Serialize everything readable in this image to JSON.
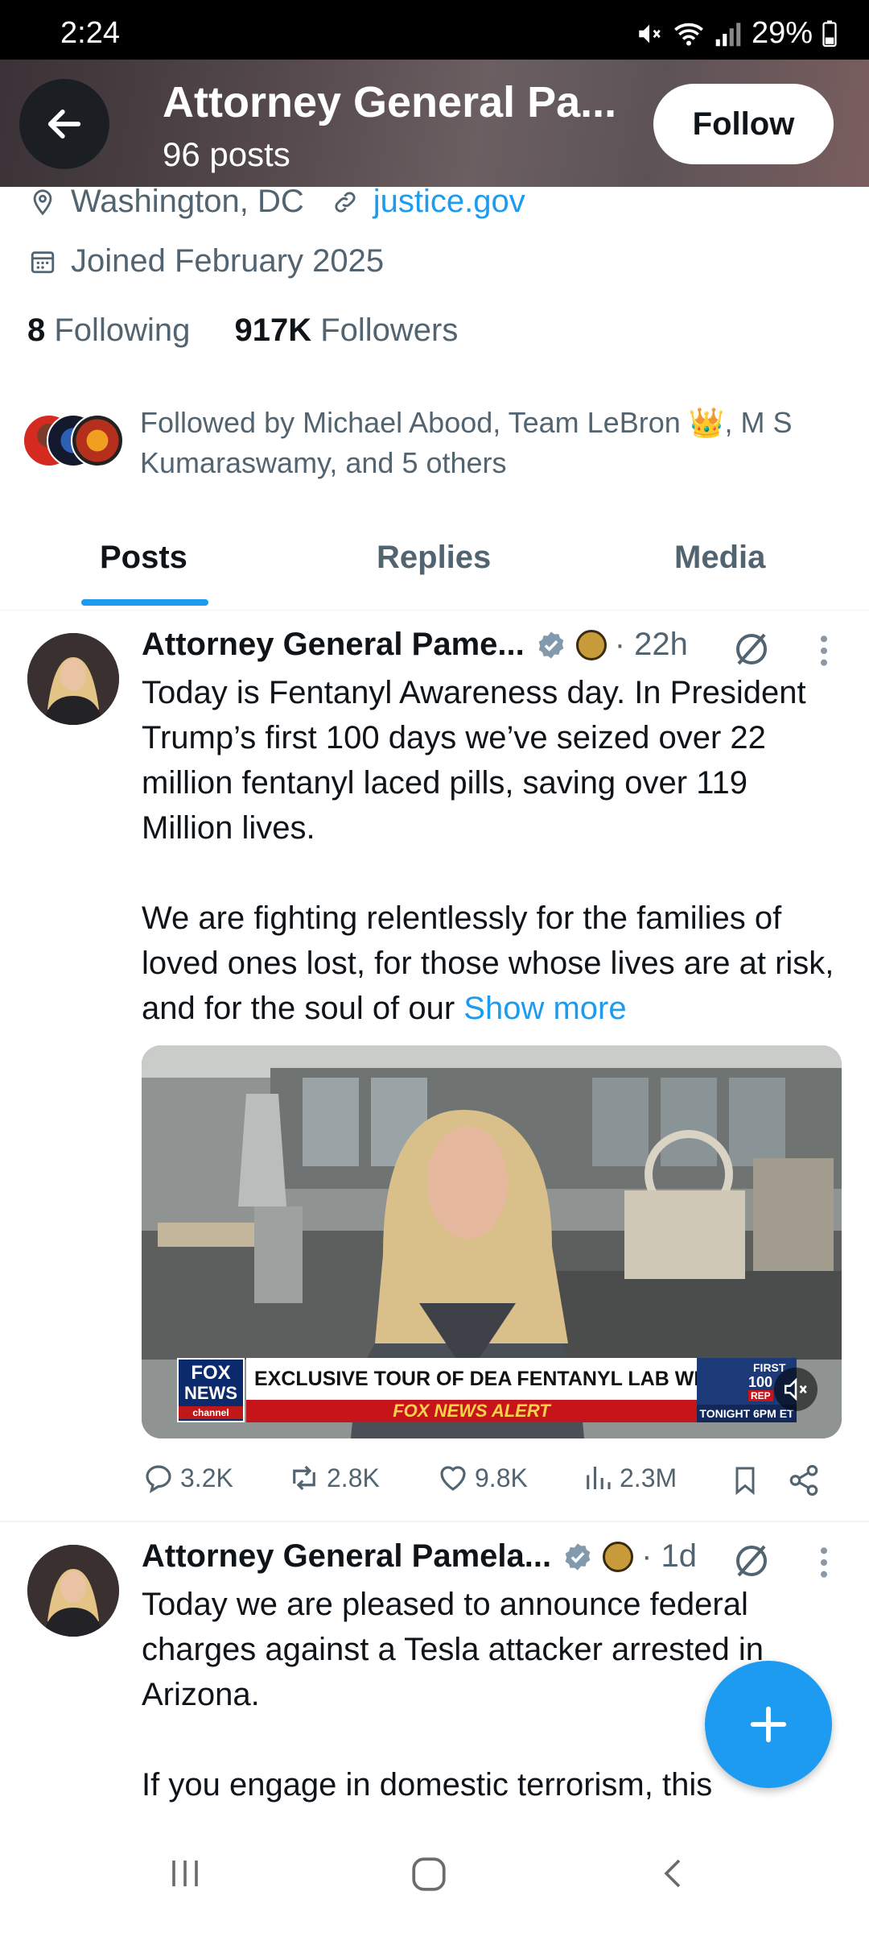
{
  "status": {
    "time": "2:24",
    "battery": "29%"
  },
  "header": {
    "title": "Attorney General Pa...",
    "posts_count": "96 posts",
    "follow_label": "Follow"
  },
  "profile": {
    "location": "Washington, DC",
    "website": "justice.gov",
    "joined": "Joined February 2025",
    "following_count": "8",
    "following_label": "Following",
    "followers_count": "917K",
    "followers_label": "Followers",
    "followed_by": "Followed by Michael Abood, Team LeBron 👑, M S Kumaraswamy, and 5 others"
  },
  "tabs": [
    {
      "label": "Posts",
      "active": true
    },
    {
      "label": "Replies",
      "active": false
    },
    {
      "label": "Media",
      "active": false
    }
  ],
  "posts": [
    {
      "author": "Attorney General Pame...",
      "time": "· 22h",
      "text": "Today is Fentanyl Awareness day. In President Trump’s first 100 days we’ve seized over 22 million fentanyl laced pills, saving over 119 Million lives.\n\nWe are fighting relentlessly for the families of loved ones lost, for those whose lives are at risk, and for the soul of our ",
      "show_more": "Show more",
      "media": {
        "fox_logo_top": "FOX",
        "fox_logo_bottom": "NEWS",
        "fox_channel": "channel",
        "headline": "EXCLUSIVE TOUR OF DEA FENTANYL LAB WITH AG BONDI",
        "alert": "FOX NEWS ALERT",
        "promo_top": "FIRST",
        "promo_mid": "100",
        "promo_small": "REP",
        "promo_bottom": "TONIGHT 6PM ET"
      },
      "replies": "3.2K",
      "reposts": "2.8K",
      "likes": "9.8K",
      "views": "2.3M"
    },
    {
      "author": "Attorney General Pamela...",
      "time": "· 1d",
      "text": "Today we are pleased to announce federal charges against a Tesla attacker arrested in Arizona.\n\nIf you engage in domestic terrorism, this"
    }
  ],
  "colors": {
    "accent": "#1d9bf0",
    "text": "#0f1419",
    "muted": "#536471"
  },
  "icons": [
    "back-arrow-icon",
    "location-icon",
    "link-icon",
    "calendar-icon",
    "verified-icon",
    "grok-icon",
    "more-icon",
    "reply-icon",
    "repost-icon",
    "like-icon",
    "views-icon",
    "bookmark-icon",
    "share-icon",
    "plus-icon",
    "mute-icon"
  ]
}
